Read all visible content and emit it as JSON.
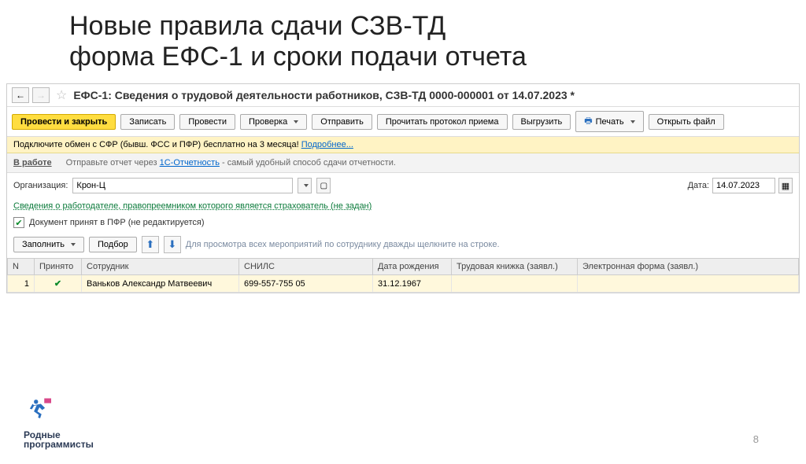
{
  "slide": {
    "title_line1": "Новые правила сдачи СЗВ-ТД",
    "title_line2": "форма ЕФС-1 и сроки подачи отчета",
    "page_number": "8",
    "logo_line1": "Родные",
    "logo_line2": "программисты"
  },
  "doc": {
    "title": "ЕФС-1: Сведения о трудовой деятельности работников, СЗВ-ТД 0000-000001 от 14.07.2023 *"
  },
  "toolbar": {
    "post_close": "Провести и закрыть",
    "save": "Записать",
    "post": "Провести",
    "check": "Проверка",
    "send": "Отправить",
    "read_protocol": "Прочитать протокол приема",
    "export": "Выгрузить",
    "print": "Печать",
    "open_file": "Открыть файл"
  },
  "info_bar": {
    "text": "Подключите обмен с СФР (бывш. ФСС и ПФР) бесплатно на 3 месяца! ",
    "link": "Подробнее..."
  },
  "status": {
    "in_work": "В работе",
    "hint_prefix": "Отправьте отчет через ",
    "hint_link": "1С-Отчетность",
    "hint_suffix": " - самый удобный способ сдачи отчетности."
  },
  "form": {
    "org_label": "Организация:",
    "org_value": "Крон-Ц",
    "date_label": "Дата:",
    "date_value": "14.07.2023",
    "employer_link": "Сведения о работодателе, правопреемником которого является страхователь (не задан)",
    "doc_accepted": "Документ принят в ПФР (не редактируется)"
  },
  "actions": {
    "fill": "Заполнить",
    "pick": "Подбор",
    "row_hint": "Для просмотра всех мероприятий по сотруднику дважды щелкните на строке."
  },
  "table": {
    "headers": {
      "n": "N",
      "accepted": "Принято",
      "employee": "Сотрудник",
      "snils": "СНИЛС",
      "birth": "Дата рождения",
      "workbook": "Трудовая книжка (заявл.)",
      "eform": "Электронная форма (заявл.)"
    },
    "rows": [
      {
        "n": "1",
        "accepted": true,
        "employee": "Ваньков Александр Матвеевич",
        "snils": "699-557-755 05",
        "birth": "31.12.1967",
        "workbook": "",
        "eform": ""
      }
    ]
  }
}
